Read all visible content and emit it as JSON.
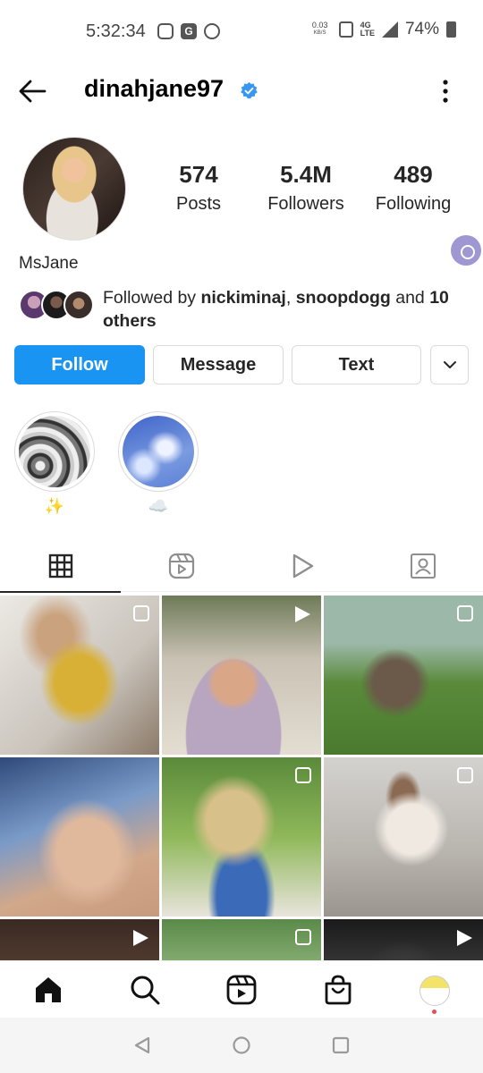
{
  "status_bar": {
    "time": "5:32:34",
    "net_speed_value": "0.03",
    "net_speed_unit": "KB/S",
    "network_type": "4G LTE",
    "battery": "74%"
  },
  "header": {
    "username": "dinahjane97",
    "verified": true
  },
  "profile": {
    "stats": [
      {
        "value": "574",
        "label": "Posts"
      },
      {
        "value": "5.4M",
        "label": "Followers"
      },
      {
        "value": "489",
        "label": "Following"
      }
    ],
    "display_name": "MsJane",
    "followed_by": {
      "prefix": "Followed by ",
      "user1": "nickiminaj",
      "sep": ", ",
      "user2": "snoopdogg",
      "and": " and ",
      "others": "10 others"
    }
  },
  "actions": {
    "follow": "Follow",
    "message": "Message",
    "text": "Text"
  },
  "highlights": [
    {
      "label": "✨"
    },
    {
      "label": "☁️"
    }
  ],
  "tabs": [
    "grid",
    "reels",
    "videos",
    "tagged"
  ],
  "grid": {
    "posts": [
      {
        "type": "carousel"
      },
      {
        "type": "reel"
      },
      {
        "type": "carousel"
      },
      {
        "type": "none"
      },
      {
        "type": "carousel"
      },
      {
        "type": "carousel"
      },
      {
        "type": "reel"
      },
      {
        "type": "carousel"
      },
      {
        "type": "reel"
      }
    ]
  },
  "colors": {
    "follow_blue": "#1a94f3",
    "verified_blue": "#3897f0",
    "notification_red": "#ed4956"
  }
}
